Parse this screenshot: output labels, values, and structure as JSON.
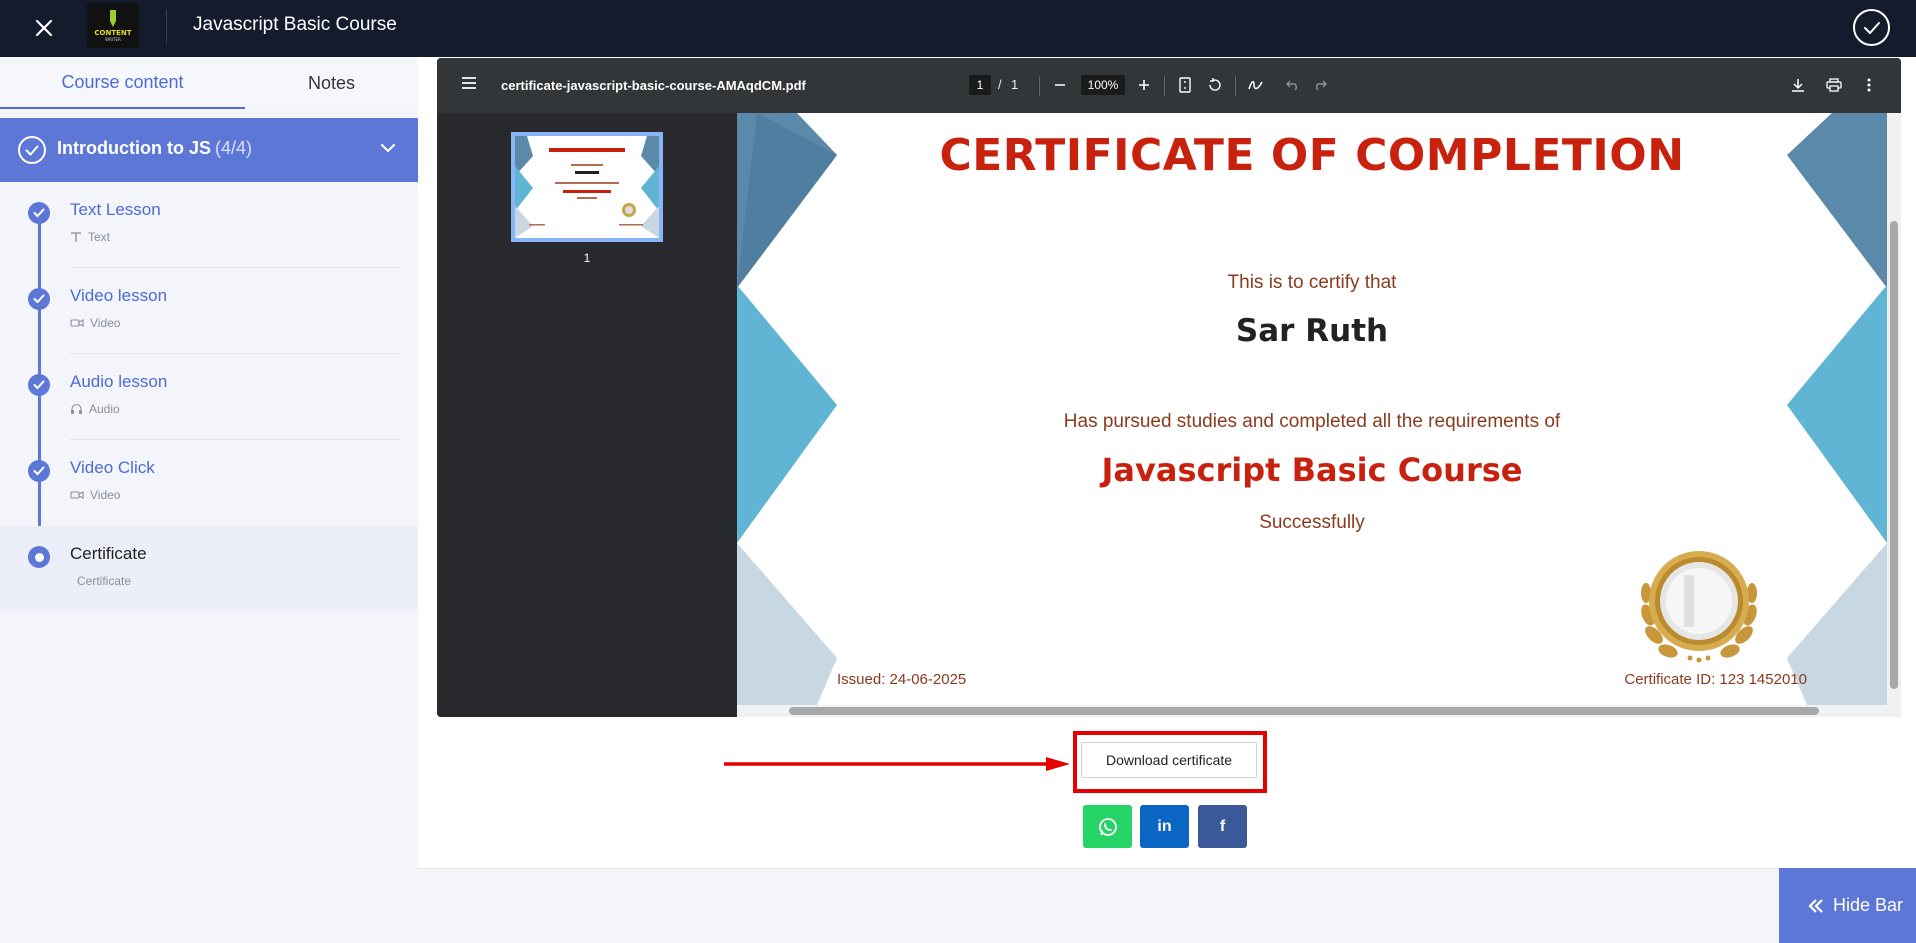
{
  "topbar": {
    "title": "Javascript Basic Course",
    "logo_text": "CONTENT",
    "logo_sub": "WRITER"
  },
  "tabs": [
    {
      "label": "Course content",
      "active": true
    },
    {
      "label": "Notes",
      "active": false
    }
  ],
  "section": {
    "title": "Introduction to JS",
    "count": "(4/4)"
  },
  "lessons": [
    {
      "title": "Text Lesson",
      "type": "Text",
      "icon": "text-icon",
      "done": true
    },
    {
      "title": "Video lesson",
      "type": "Video",
      "icon": "video-icon",
      "done": true
    },
    {
      "title": "Audio lesson",
      "type": "Audio",
      "icon": "headphones-icon",
      "done": true
    },
    {
      "title": "Video Click",
      "type": "Video",
      "icon": "video-icon",
      "done": true
    },
    {
      "title": "Certificate",
      "type": "Certificate",
      "icon": "",
      "done": false,
      "active": true
    }
  ],
  "pdf": {
    "filename": "certificate-javascript-basic-course-AMAqdCM.pdf",
    "page_current": "1",
    "page_total": "1",
    "page_slash": "/",
    "zoom": "100%",
    "thumb_label": "1"
  },
  "certificate": {
    "title": "CERTIFICATE OF COMPLETION",
    "certify_text": "This is to certify that",
    "name": "Sar Ruth",
    "pursued_text": "Has pursued studies and completed all the requirements of",
    "course": "Javascript Basic Course",
    "success_text": "Successfully",
    "issued": "Issued: 24-06-2025",
    "certificate_id": "Certificate ID: 123 1452010"
  },
  "actions": {
    "download_label": "Download certificate",
    "share_linkedin": "in",
    "share_facebook": "f",
    "hide_bar_label": "Hide Bar"
  },
  "colors": {
    "topbar": "#141b2d",
    "accent": "#5d77d6",
    "highlight": "#e60000",
    "cert_red": "#c8220e",
    "whatsapp": "#25d366",
    "linkedin": "#0a66c2",
    "facebook": "#3b5998"
  }
}
